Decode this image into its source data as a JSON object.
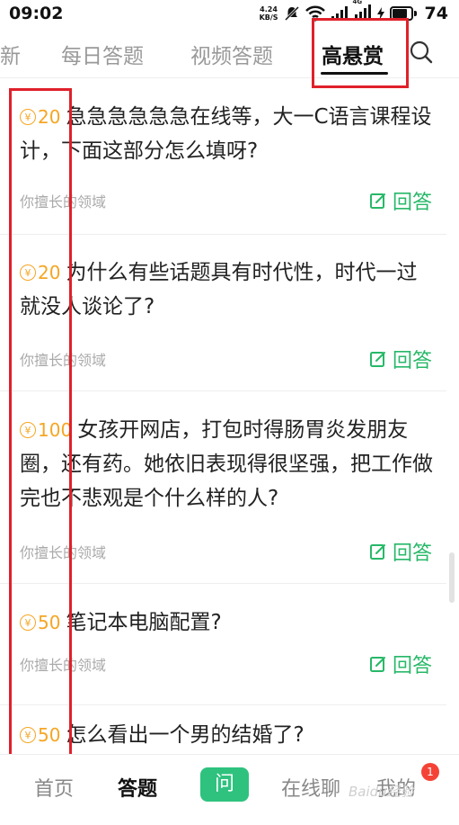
{
  "status_bar": {
    "time": "09:02",
    "net_speed_value": "4.24",
    "net_speed_unit": "KB/S",
    "network_label": "4G",
    "battery_level": "74"
  },
  "tabs": [
    {
      "label": "新",
      "active": false
    },
    {
      "label": "每日答题",
      "active": false
    },
    {
      "label": "视频答题",
      "active": false
    },
    {
      "label": "高悬赏",
      "active": true
    }
  ],
  "questions": [
    {
      "reward": "20",
      "text": "急急急急急急在线等，大一C语言课程设计，下面这部分怎么填呀?",
      "domain": "你擅长的领域",
      "answer_label": "回答"
    },
    {
      "reward": "20",
      "text": "为什么有些话题具有时代性，时代一过就没人谈论了?",
      "domain": "你擅长的领域",
      "answer_label": "回答"
    },
    {
      "reward": "100",
      "text": "女孩开网店，打包时得肠胃炎发朋友圈，还有药。她依旧表现得很坚强，把工作做完也不悲观是个什么样的人?",
      "domain": "你擅长的领域",
      "answer_label": "回答"
    },
    {
      "reward": "50",
      "text": "笔记本电脑配置?",
      "domain": "你擅长的领域",
      "answer_label": "回答"
    },
    {
      "reward": "50",
      "text": "怎么看出一个男的结婚了?",
      "domain": "",
      "answer_label": ""
    }
  ],
  "bottom_nav": {
    "home": "首页",
    "answer": "答题",
    "ask": "问",
    "chat": "在线聊",
    "mine": "我的",
    "mine_badge": "1",
    "watermark": "Baidu经验"
  },
  "colors": {
    "accent_green": "#27b868",
    "reward_gold": "#f5a623",
    "highlight_red": "#e0202a"
  }
}
